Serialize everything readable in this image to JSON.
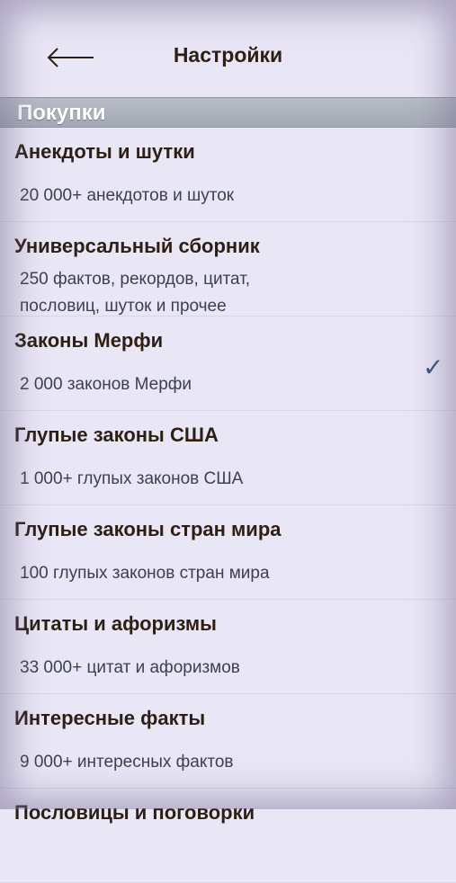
{
  "header": {
    "title": "Настройки",
    "back_icon": "arrow-left-icon"
  },
  "section": {
    "label": "Покупки"
  },
  "items": [
    {
      "title": "Анекдоты и шутки",
      "subtitle": "20 000+ анекдотов и шуток",
      "checked": false
    },
    {
      "title": "Универсальный сборник",
      "subtitle_lines": [
        "250 фактов, рекордов, цитат,",
        "пословиц, шуток и прочее"
      ],
      "checked": false
    },
    {
      "title": "Законы Мерфи",
      "subtitle": "2 000 законов Мерфи",
      "checked": true,
      "check_glyph": "✓"
    },
    {
      "title": "Глупые законы США",
      "subtitle": "1 000+ глупых законов США",
      "checked": false
    },
    {
      "title": "Глупые законы стран мира",
      "subtitle": "100 глупых законов стран мира",
      "checked": false
    },
    {
      "title": "Цитаты и афоризмы",
      "subtitle": "33 000+ цитат и афоризмов",
      "checked": false
    },
    {
      "title": "Интересные факты",
      "subtitle": "9 000+ интересных фактов",
      "checked": false
    },
    {
      "title": "Пословицы и поговорки",
      "subtitle": "",
      "checked": false
    }
  ]
}
